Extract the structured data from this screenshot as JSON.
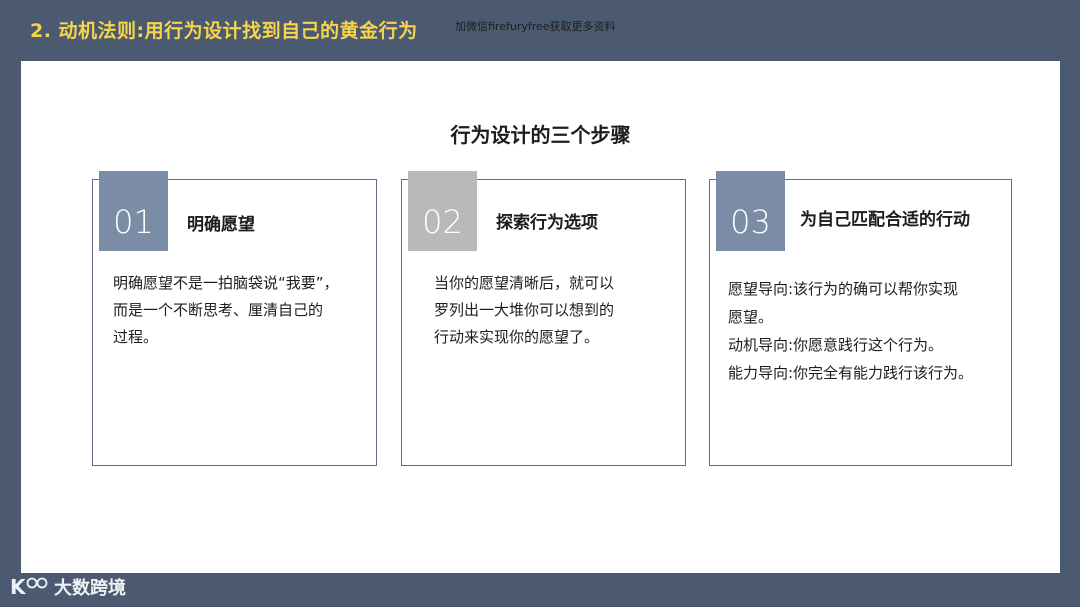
{
  "header": {
    "title": "2. 动机法则:用行为设计找到自己的黄金行为",
    "watermark": "加微信firefuryfree获取更多资料"
  },
  "main": {
    "title": "行为设计的三个步骤"
  },
  "cards": [
    {
      "number": "01",
      "title": "明确愿望",
      "color": "#7b8ca6",
      "lines": [
        "明确愿望不是一拍脑袋说“我要”，",
        "而是一个不断思考、厘清自己的",
        "过程。"
      ]
    },
    {
      "number": "02",
      "title": "探索行为选项",
      "color": "#b9b9b9",
      "lines": [
        "当你的愿望清晰后，就可以",
        "罗列出一大堆你可以想到的",
        "行动来实现你的愿望了。"
      ]
    },
    {
      "number": "03",
      "title": "为自己匹配合适的行动",
      "color": "#7b8ca6",
      "lines": [
        "愿望导向:该行为的确可以帮你实现",
        "愿望。",
        "动机导向:你愿意践行这个行为。",
        "能力导向:你完全有能力践行该行为。"
      ]
    }
  ],
  "footer": {
    "brand": "大数跨境",
    "logo_mark": "K"
  }
}
